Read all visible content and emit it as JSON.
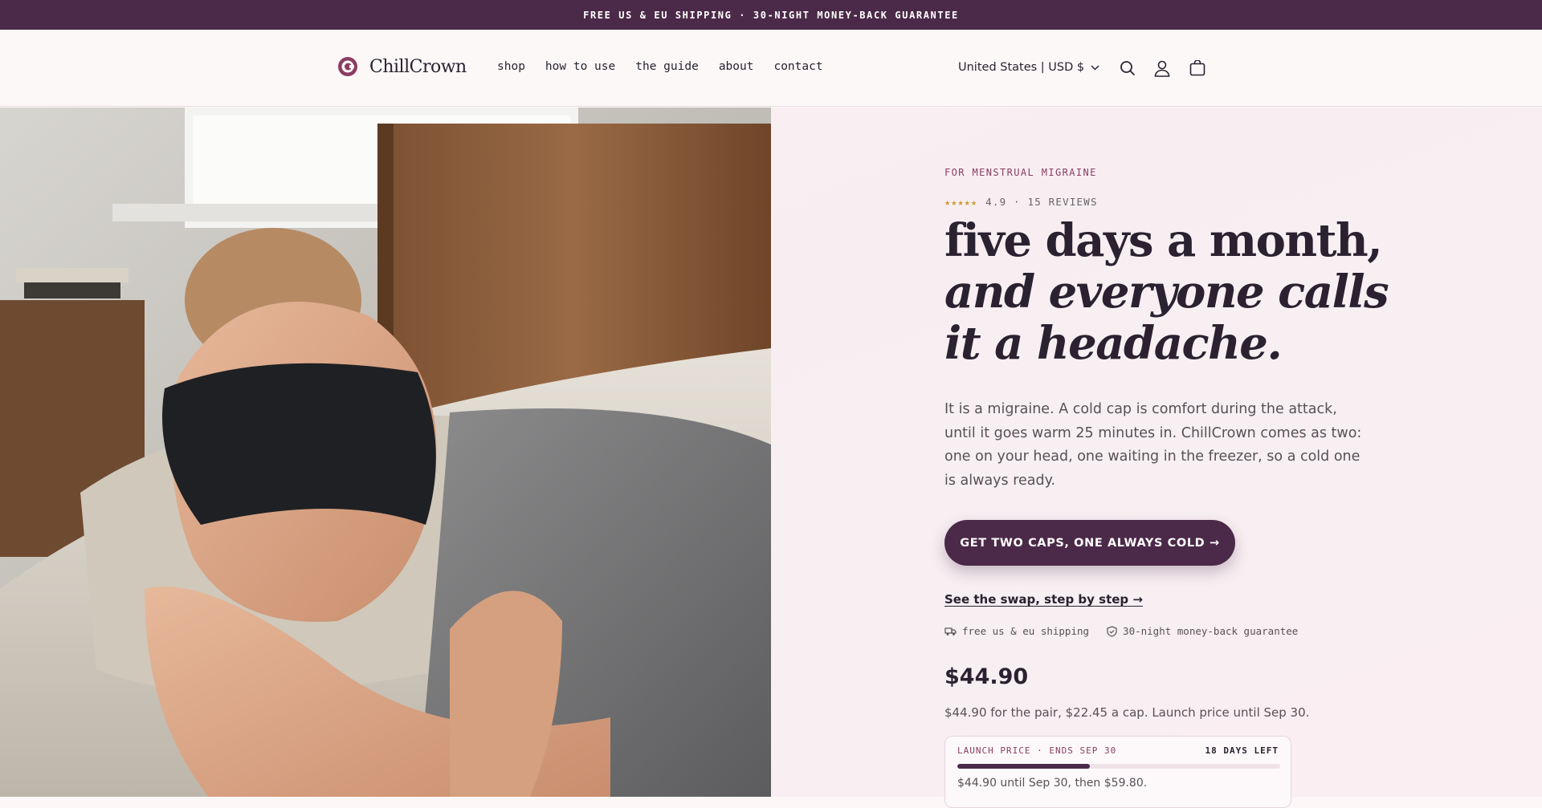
{
  "announcement": "FREE US & EU SHIPPING · 30-NIGHT MONEY-BACK GUARANTEE",
  "header": {
    "brand": "ChillCrown",
    "nav": [
      "shop",
      "how to use",
      "the guide",
      "about",
      "contact"
    ],
    "locale": "United States | USD $",
    "icons": [
      "search-icon",
      "account-icon",
      "cart-icon"
    ]
  },
  "hero": {
    "eyebrow": "FOR MENSTRUAL MIGRAINE",
    "stars": "★★★★★",
    "rating_text": "4.9 · 15 REVIEWS",
    "headline_line1": "five days a month,",
    "headline_line2": "and everyone calls it a headache.",
    "lead": "It is a migraine. A cold cap is comfort during the attack, until it goes warm 25 minutes in. ChillCrown comes as two: one on your head, one waiting in the freezer, so a cold one is always ready.",
    "cta": "GET TWO CAPS, ONE ALWAYS COLD →",
    "secondary_link": "See the swap, step by step →",
    "trust": [
      "free us & eu shipping",
      "30-night money-back guarantee"
    ],
    "price": "$44.90",
    "price_note": "$44.90 for the pair, $22.45 a cap. Launch price until Sep 30.",
    "launch": {
      "label": "LAUNCH PRICE · ENDS SEP 30",
      "days_left": "18 DAYS LEFT",
      "progress": 0.41,
      "note": "$44.90 until Sep 30, then $59.80."
    }
  },
  "colors": {
    "brand": "#4b2948",
    "accent": "#8a3d63",
    "star": "#d19a30",
    "panel": "#f8eef1"
  }
}
